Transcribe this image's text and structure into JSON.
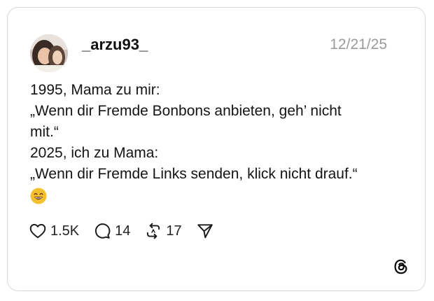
{
  "post": {
    "username": "_arzu93_",
    "timestamp": "12/21/25",
    "lines": [
      "1995, Mama zu mir:",
      "„Wenn dir Fremde Bonbons anbieten, geh’ nicht",
      "mit.“",
      "2025, ich zu Mama:",
      "„Wenn dir Fremde Links senden, klick nicht drauf.“"
    ],
    "emoji": "grinning-face-with-smiling-eyes"
  },
  "actions": {
    "likes": "1.5K",
    "replies": "14",
    "reposts": "17"
  },
  "icons": {
    "like": "heart-icon",
    "reply": "comment-bubble-icon",
    "repost": "repost-arrows-icon",
    "share": "send-icon",
    "brand": "threads-logo-icon"
  },
  "colors": {
    "card_border": "#d9d9d9",
    "timestamp": "#9a9a9a",
    "text": "#141414",
    "emoji": "#f5c02e"
  }
}
